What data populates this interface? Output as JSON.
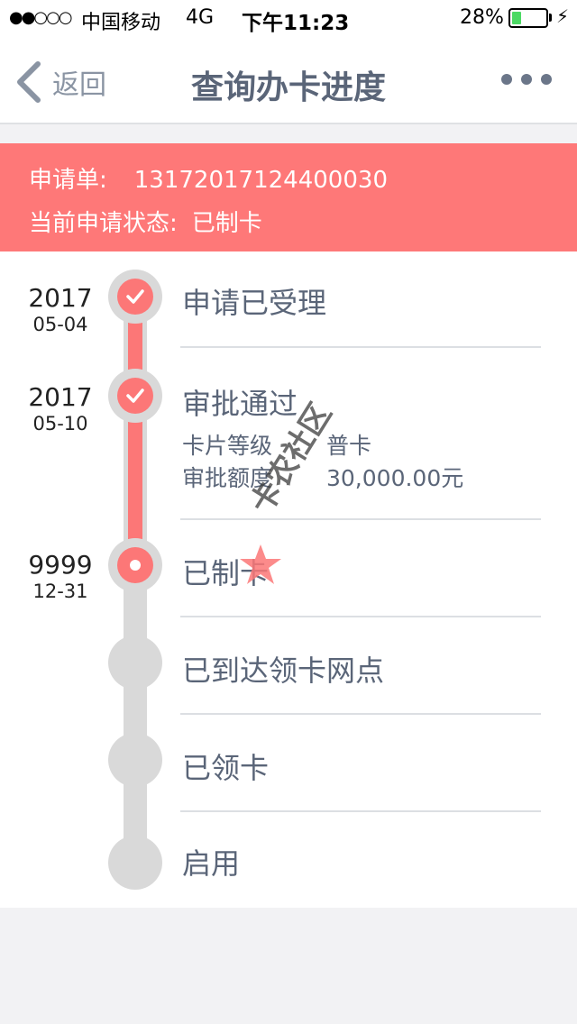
{
  "status_bar": {
    "signal": "●●○○○",
    "carrier": "中国移动",
    "network": "4G",
    "time": "下午11:23",
    "battery_percent": "28%",
    "battery_level": 0.28,
    "charging_icon": "⚡"
  },
  "nav": {
    "back_label": "返回",
    "title": "查询办卡进度",
    "more_icon": "more-dots-icon"
  },
  "banner": {
    "application_label": "申请单:",
    "application_number": "13172017124400030",
    "status_label": "当前申请状态:",
    "status_value": "已制卡"
  },
  "timeline": {
    "steps": [
      {
        "label": "申请已受理",
        "year": "2017",
        "date": "05-04",
        "state": "done"
      },
      {
        "label": "审批通过",
        "year": "2017",
        "date": "05-10",
        "state": "done",
        "details": [
          {
            "key": "卡片等级",
            "value": "普卡"
          },
          {
            "key": "审批额度",
            "value": "30,000.00元"
          }
        ]
      },
      {
        "label": "已制卡",
        "year": "9999",
        "date": "12-31",
        "state": "current"
      },
      {
        "label": "已到达领卡网点",
        "state": "pending"
      },
      {
        "label": "已领卡",
        "state": "pending"
      },
      {
        "label": "启用",
        "state": "pending"
      }
    ]
  },
  "watermark": {
    "text": "卡农社区"
  },
  "colors": {
    "accent": "#fe7878",
    "track_inactive": "#d9d9d9",
    "text": "#5a6578"
  }
}
